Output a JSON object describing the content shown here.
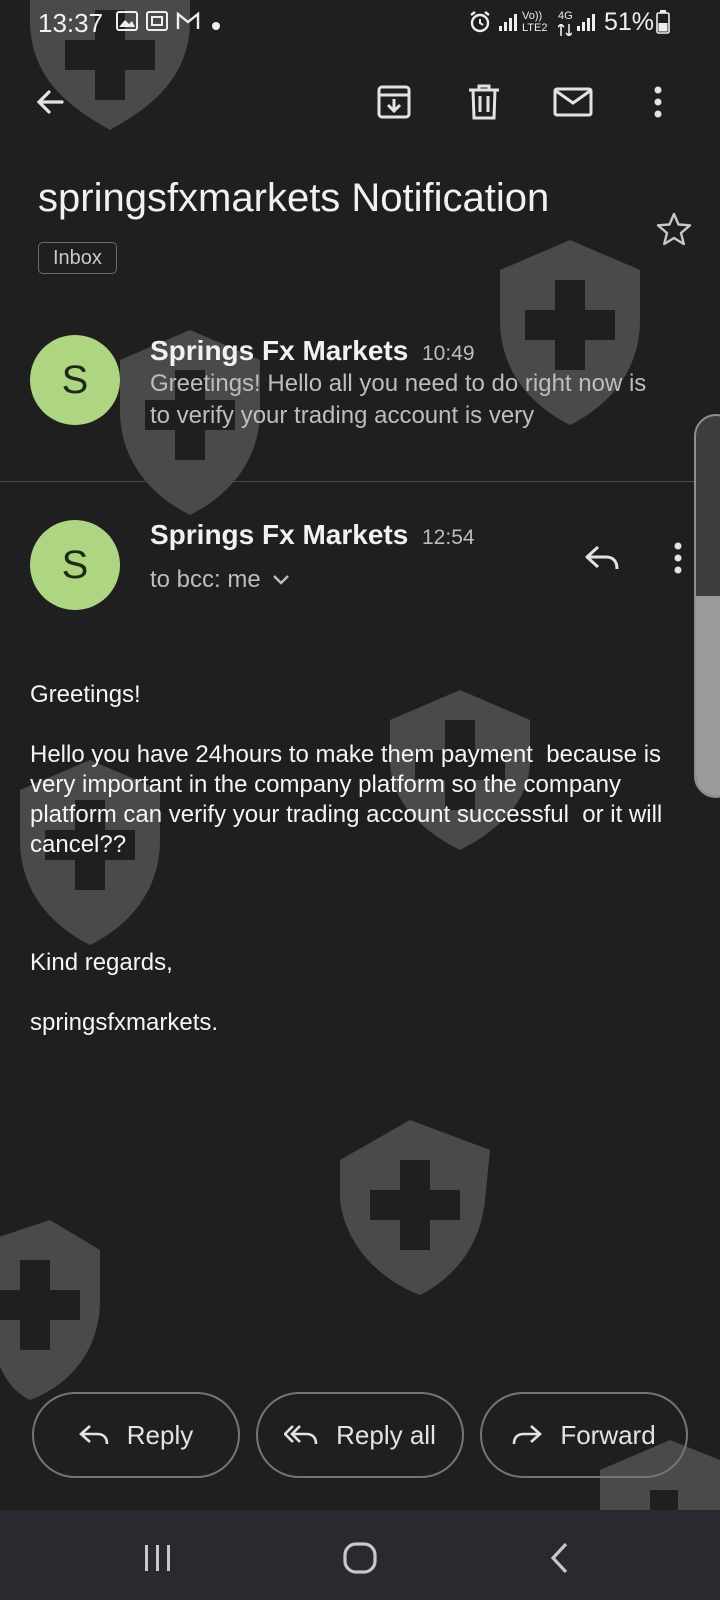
{
  "status_bar": {
    "time": "13:37",
    "network_label": "Vo)) LTE2",
    "network_type": "4G",
    "battery": "51%"
  },
  "toolbar": {
    "back_icon": "arrow-back-icon",
    "archive_icon": "archive-icon",
    "delete_icon": "trash-icon",
    "mark_unread_icon": "mail-icon",
    "more_icon": "more-vert-icon"
  },
  "email": {
    "subject": "springsfxmarkets Notification",
    "label": "Inbox"
  },
  "thread": {
    "first_message": {
      "avatar_letter": "S",
      "sender": "Springs Fx Markets",
      "time": "10:49",
      "snippet": "Greetings! Hello all you need to do right now is to verify your trading account is very"
    },
    "second_message": {
      "avatar_letter": "S",
      "sender": "Springs Fx Markets",
      "time": "12:54",
      "recipients": "to bcc: me",
      "body_greeting": "Greetings!",
      "body_paragraph": "Hello you have 24hours to make them payment  because is very important in the company platform so the company platform can verify your trading account successful  or it will cancel??",
      "body_signoff": "Kind regards,",
      "body_signature": "springsfxmarkets."
    }
  },
  "actions": {
    "reply_label": "Reply",
    "reply_all_label": "Reply all",
    "forward_label": "Forward"
  },
  "colors": {
    "background": "#1f1f1f",
    "avatar": "#aed581",
    "navbar": "#292a30"
  }
}
